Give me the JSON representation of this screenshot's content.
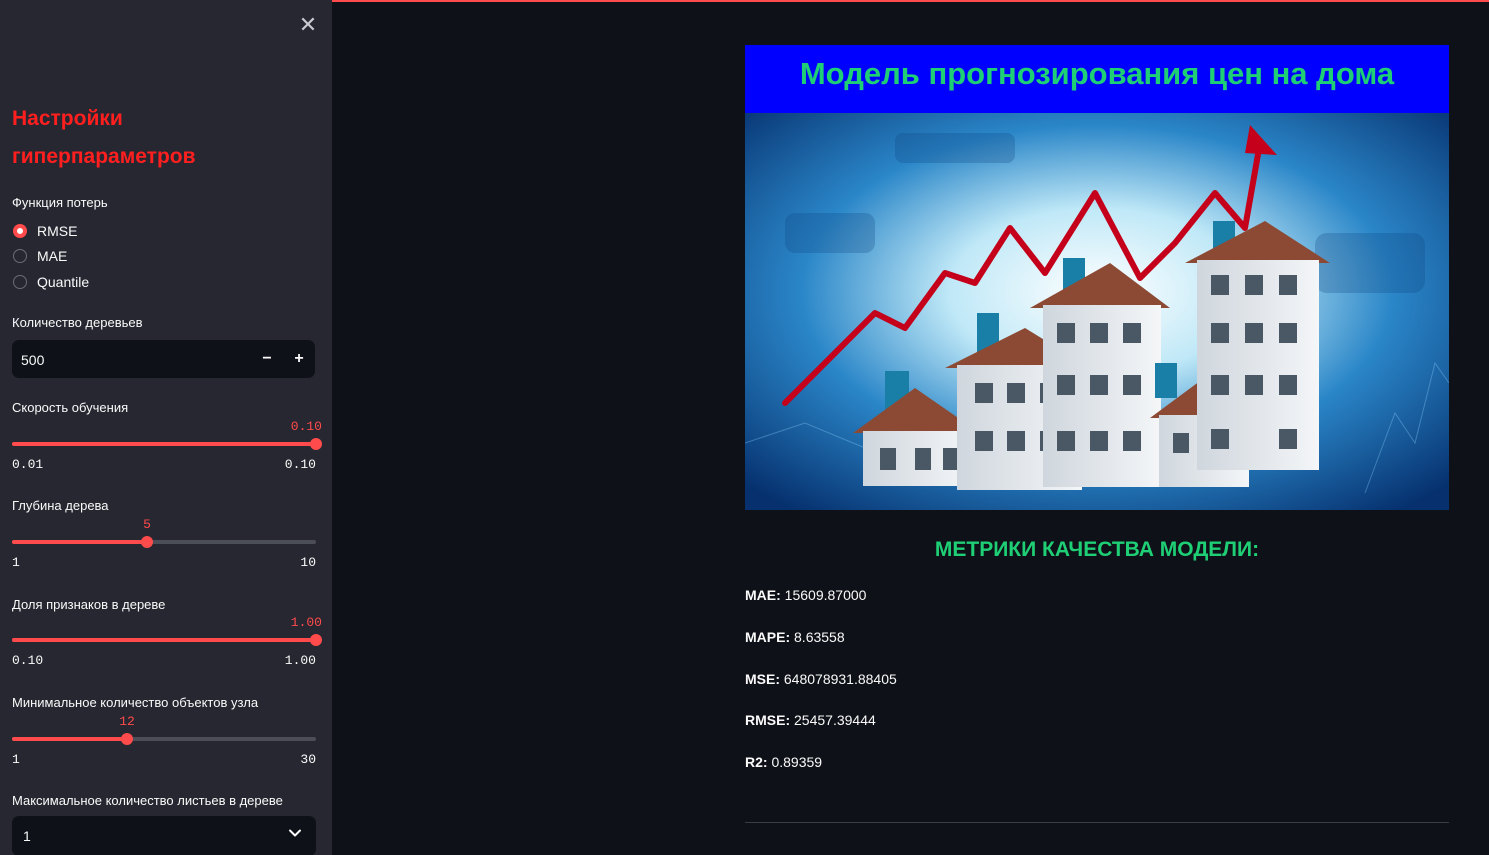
{
  "sidebar": {
    "close_icon": "close-icon",
    "title": "Настройки гиперпараметров",
    "loss": {
      "label": "Функция потерь",
      "options": [
        "RMSE",
        "MAE",
        "Quantile"
      ],
      "selected": "RMSE"
    },
    "n_trees": {
      "label": "Количество деревьев",
      "value": "500",
      "minus": "−",
      "plus": "+"
    },
    "learning_rate": {
      "label": "Скорость обучения",
      "value": "0.10",
      "min": "0.01",
      "max": "0.10",
      "fraction": 1.0
    },
    "depth": {
      "label": "Глубина дерева",
      "value": "5",
      "min": "1",
      "max": "10",
      "fraction": 0.4444
    },
    "feature_fraction": {
      "label": "Доля признаков в дереве",
      "value": "1.00",
      "min": "0.10",
      "max": "1.00",
      "fraction": 1.0
    },
    "min_samples": {
      "label": "Минимальное количество объектов узла",
      "value": "12",
      "min": "1",
      "max": "30",
      "fraction": 0.3793
    },
    "max_leaves": {
      "label": "Максимальное количество листьев в дереве",
      "value": "1",
      "chevron_icon": "chevron-down-icon"
    }
  },
  "main": {
    "title": "Модель прогнозирования цен на дома",
    "hero_image": "houses-rising-chart-image",
    "metrics_title": "МЕТРИКИ КАЧЕСТВА МОДЕЛИ:",
    "metrics": [
      {
        "name": "MAE:",
        "value": " 15609.87000"
      },
      {
        "name": "MAPE:",
        "value": " 8.63558"
      },
      {
        "name": "MSE:",
        "value": " 648078931.88405"
      },
      {
        "name": "RMSE:",
        "value": " 25457.39444"
      },
      {
        "name": "R2:",
        "value": " 0.89359"
      }
    ]
  },
  "colors": {
    "accent": "#ff4b4b",
    "title_red": "#ff1f1f",
    "green": "#1fcf75",
    "banner_blue": "#0000ff",
    "background": "#0e1117",
    "sidebar": "#262730"
  }
}
